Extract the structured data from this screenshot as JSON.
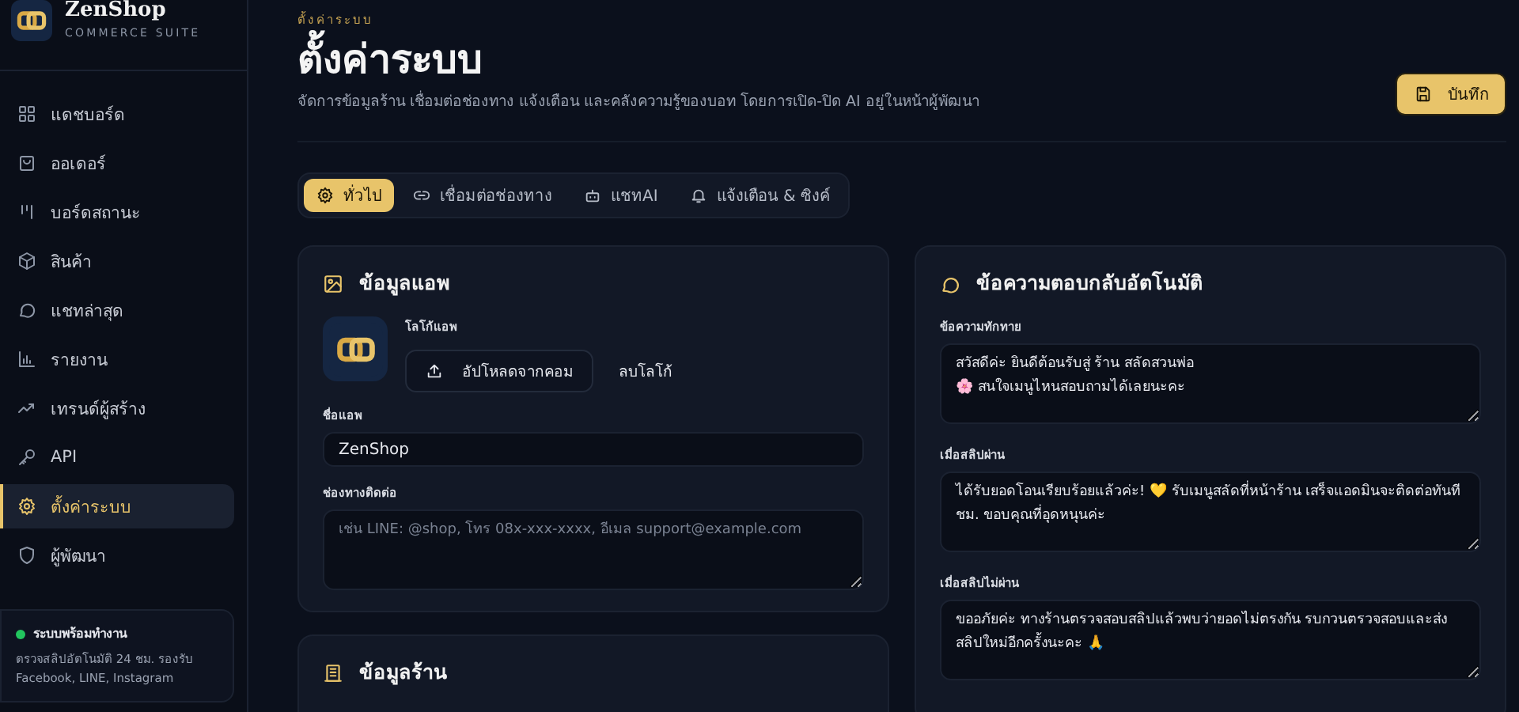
{
  "app": {
    "name": "ZenShop",
    "tagline": "COMMERCE SUITE"
  },
  "sidebar": {
    "items": [
      {
        "label": "แดชบอร์ด",
        "selected": false
      },
      {
        "label": "ออเดอร์",
        "selected": false
      },
      {
        "label": "บอร์ดสถานะ",
        "selected": false
      },
      {
        "label": "สินค้า",
        "selected": false
      },
      {
        "label": "แชทล่าสุด",
        "selected": false
      },
      {
        "label": "รายงาน",
        "selected": false
      },
      {
        "label": "เทรนด์ผู้สร้าง",
        "selected": false
      },
      {
        "label": "API",
        "selected": false
      },
      {
        "label": "ตั้งค่าระบบ",
        "selected": true
      },
      {
        "label": "ผู้พัฒนา",
        "selected": false
      }
    ],
    "status": {
      "title": "ระบบพร้อมทำงาน",
      "description": "ตรวจสลิปอัตโนมัติ 24 ชม. รองรับ Facebook, LINE, Instagram"
    }
  },
  "header": {
    "breadcrumb": "ตั้งค่าระบบ",
    "title": "ตั้งค่าระบบ",
    "subtitle": "จัดการข้อมูลร้าน เชื่อมต่อช่องทาง แจ้งเตือน และคลังความรู้ของบอท โดยการเปิด-ปิด AI อยู่ในหน้าผู้พัฒนา",
    "save_button": "บันทึก"
  },
  "tabs": [
    {
      "label": "ทั่วไป",
      "selected": true
    },
    {
      "label": "เชื่อมต่อช่องทาง",
      "selected": false
    },
    {
      "label": "แชทAI",
      "selected": false
    },
    {
      "label": "แจ้งเตือน & ซิงค์",
      "selected": false
    }
  ],
  "app_info": {
    "title": "ข้อมูลแอพ",
    "logo_label": "โลโก้แอพ",
    "upload_button": "อัปโหลดจากคอม",
    "remove_button": "ลบโลโก้",
    "fields": [
      {
        "label": "ชื่อแอพ",
        "kind": "input",
        "value": "ZenShop"
      },
      {
        "label": "ช่องทางติดต่อ",
        "kind": "textarea",
        "placeholder": "เช่น LINE: @shop, โทร 08x-xxx-xxxx, อีเมล support@example.com"
      }
    ]
  },
  "shop_info": {
    "title": "ข้อมูลร้าน"
  },
  "auto_reply": {
    "title": "ข้อความตอบกลับอัตโนมัติ",
    "fields": [
      {
        "label": "ข้อความทักทาย",
        "value": "สวัสดีค่ะ ยินดีต้อนรับสู่ ร้าน สลัดสวนพ่อ\n🌸 สนใจเมนูไหนสอบถามได้เลยนะคะ"
      },
      {
        "label": "เมื่อสลิปผ่าน",
        "value": "ได้รับยอดโอนเรียบร้อยแล้วค่ะ! 💛 รับเมนูสลัดที่หน้าร้าน เสร็จแอดมินจะติดต่อทันที ชม. ขอบคุณที่อุดหนุนค่ะ"
      },
      {
        "label": "เมื่อสลิปไม่ผ่าน",
        "value": "ขออภัยค่ะ ทางร้านตรวจสอบสลิปแล้วพบว่ายอดไม่ตรงกัน รบกวนตรวจสอบและส่งสลิปใหม่อีกครั้งนะคะ 🙏"
      }
    ]
  }
}
